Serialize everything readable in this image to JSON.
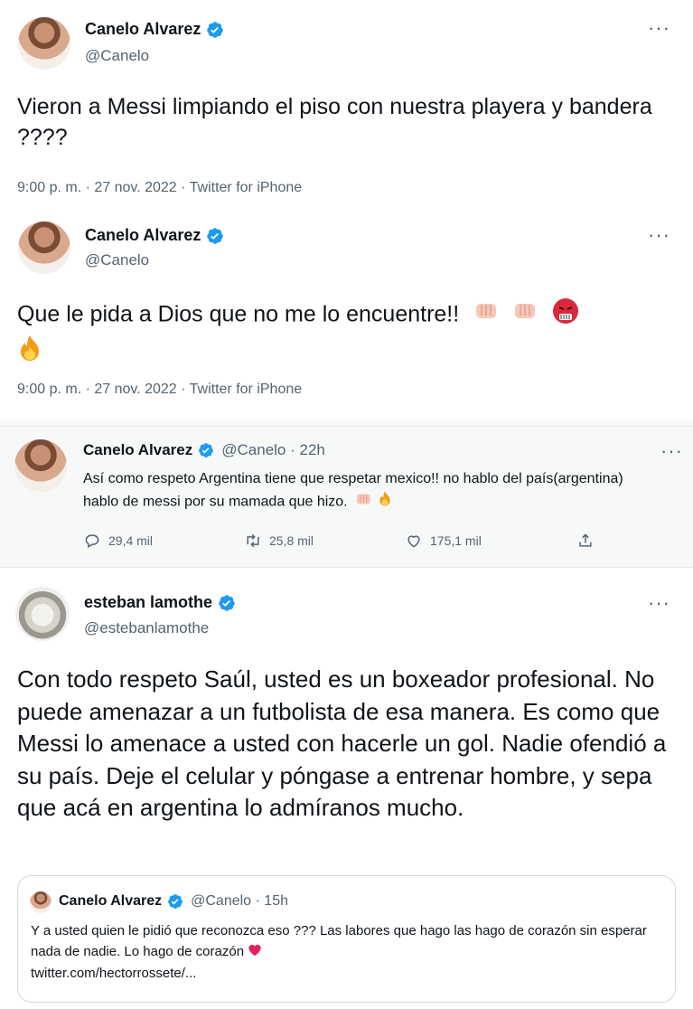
{
  "tweet1": {
    "name": "Canelo Alvarez",
    "handle": "@Canelo",
    "text": "Vieron a Messi limpiando el piso con nuestra playera y bandera ????",
    "meta": "9:00 p. m. · 27 nov. 2022 · Twitter for iPhone"
  },
  "tweet2": {
    "name": "Canelo Alvarez",
    "handle": "@Canelo",
    "text": "Que le pida a Dios que no me lo encuentre!!",
    "meta": "9:00 p. m. · 27 nov. 2022 · Twitter for iPhone"
  },
  "tweet3": {
    "name": "Canelo Alvarez",
    "handle_time": "@Canelo · 22h",
    "text": "Así como respeto Argentina tiene que respetar mexico!! no hablo del país(argentina) hablo de messi por su mamada que hizo.",
    "replies": "29,4 mil",
    "retweets": "25,8 mil",
    "likes": "175,1 mil"
  },
  "tweet4": {
    "name": "esteban lamothe",
    "handle": "@estebanlamothe",
    "text": "Con todo respeto Saúl, usted es un boxeador profesional. No puede amenazar a un futbolista de esa manera. Es como que Messi lo amenace a usted con hacerle un gol. Nadie ofendió a su país. Deje el celular y póngase a entrenar hombre, y sepa que acá en argentina lo admíranos mucho."
  },
  "quote": {
    "name": "Canelo Alvarez",
    "handle_time": "@Canelo · 15h",
    "text": "Y a usted quien le pidió que reconozca eso ??? Las labores que hago las hago de corazón sin esperar nada de nadie. Lo hago de corazón",
    "link": "twitter.com/hectorrossete/..."
  },
  "icons": {
    "more": "more-icon",
    "verified": "verified-badge-icon",
    "reply": "reply-icon",
    "retweet": "retweet-icon",
    "like": "like-icon",
    "share": "share-icon",
    "fist": "oncoming-fist-emoji",
    "fire": "fire-emoji",
    "angry": "cursing-face-emoji",
    "heart": "red-heart-emoji"
  },
  "colors": {
    "verified": "#1d9bf0",
    "text": "#0f1419",
    "muted": "#536471",
    "heart": "#e0245e"
  }
}
